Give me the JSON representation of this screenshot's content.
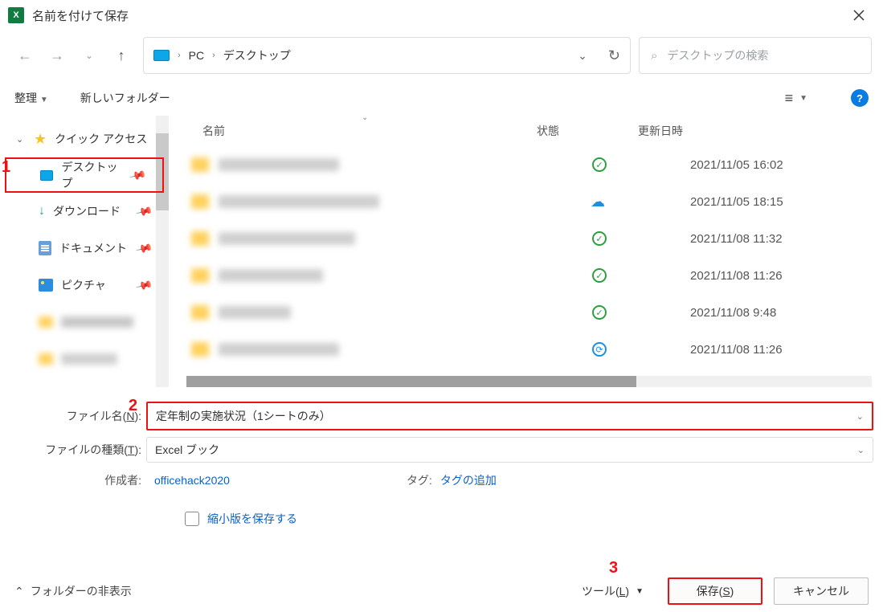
{
  "window": {
    "title": "名前を付けて保存"
  },
  "breadcrumb": {
    "pc": "PC",
    "location": "デスクトップ"
  },
  "search": {
    "placeholder": "デスクトップの検索"
  },
  "toolbar": {
    "organize": "整理",
    "new_folder": "新しいフォルダー"
  },
  "sidebar": {
    "quick_access": "クイック アクセス",
    "desktop": "デスクトップ",
    "downloads": "ダウンロード",
    "documents": "ドキュメント",
    "pictures": "ピクチャ"
  },
  "columns": {
    "name": "名前",
    "status": "状態",
    "date": "更新日時"
  },
  "files": [
    {
      "date": "2021/11/05 16:02",
      "status": "check"
    },
    {
      "date": "2021/11/05 18:15",
      "status": "cloud"
    },
    {
      "date": "2021/11/08 11:32",
      "status": "check"
    },
    {
      "date": "2021/11/08 11:26",
      "status": "check"
    },
    {
      "date": "2021/11/08 9:48",
      "status": "check"
    },
    {
      "date": "2021/11/08 11:26",
      "status": "sync"
    }
  ],
  "form": {
    "filename_label_pre": "ファイル名(",
    "filename_label_ul": "N",
    "filename_label_post": "):",
    "filename_value": "定年制の実施状況（1シートのみ）",
    "filetype_label_pre": "ファイルの種類(",
    "filetype_label_ul": "T",
    "filetype_label_post": "):",
    "filetype_value": "Excel ブック",
    "author_label": "作成者:",
    "author_value": "officehack2020",
    "tag_label": "タグ:",
    "tag_value": "タグの追加",
    "thumbnail_label": "縮小版を保存する"
  },
  "bottom": {
    "hide_folders": "フォルダーの非表示",
    "tools_pre": "ツール(",
    "tools_ul": "L",
    "tools_post": ")",
    "save_pre": "保存(",
    "save_ul": "S",
    "save_post": ")",
    "cancel": "キャンセル"
  },
  "annotations": {
    "a1": "1",
    "a2": "2",
    "a3": "3"
  }
}
